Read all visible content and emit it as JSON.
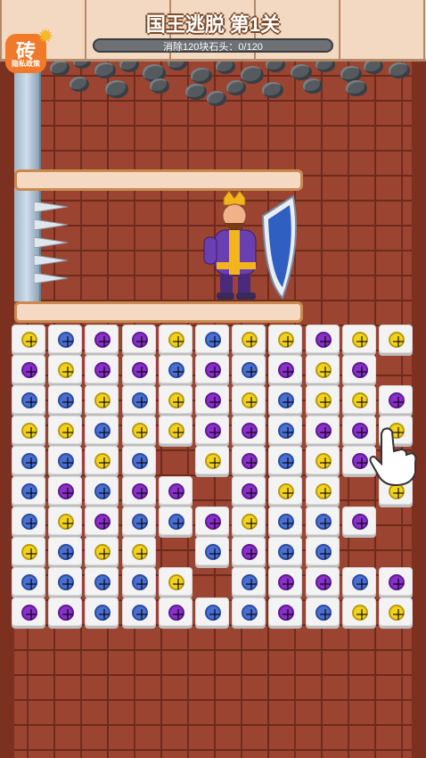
{
  "header": {
    "title": "国王逃脱  第1关",
    "progress_text": "消除120块石头：0/120"
  },
  "logo": {
    "glyph": "砖",
    "label": "隐私政策"
  },
  "icons": [
    "gear-icon",
    "pointer-hand-icon",
    "shield-icon"
  ],
  "colors": {
    "yellow": "#f3d21c",
    "purple": "#8a2fc9",
    "blue": "#4a6fd3"
  },
  "board": {
    "rows": [
      [
        [
          "y",
          0
        ],
        [
          "b",
          1
        ],
        [
          "p",
          2
        ],
        [
          "p",
          3
        ],
        [
          "y",
          4
        ],
        [
          "b",
          5
        ],
        [
          "y",
          6
        ],
        [
          "y",
          7
        ],
        [
          "p",
          8
        ],
        [
          "y",
          9
        ],
        [
          "y",
          10
        ]
      ],
      [
        [
          "p",
          0
        ],
        [
          "y",
          1
        ],
        [
          "p",
          2
        ],
        [
          "p",
          3
        ],
        [
          "b",
          4
        ],
        [
          "p",
          5
        ],
        [
          "b",
          6
        ],
        [
          "p",
          7
        ],
        [
          "y",
          8
        ],
        [
          "p",
          9
        ]
      ],
      [
        [
          "b",
          0
        ],
        [
          "b",
          1
        ],
        [
          "y",
          2
        ],
        [
          "b",
          3
        ],
        [
          "y",
          4
        ],
        [
          "p",
          5
        ],
        [
          "y",
          6
        ],
        [
          "b",
          7
        ],
        [
          "y",
          8
        ],
        [
          "y",
          9
        ],
        [
          "p",
          10
        ]
      ],
      [
        [
          "y",
          0
        ],
        [
          "y",
          1
        ],
        [
          "b",
          2
        ],
        [
          "y",
          3
        ],
        [
          "y",
          4
        ],
        [
          "p",
          5
        ],
        [
          "p",
          6
        ],
        [
          "b",
          7
        ],
        [
          "p",
          8
        ],
        [
          "p",
          9
        ],
        [
          "y",
          10
        ]
      ],
      [
        [
          "b",
          0
        ],
        [
          "b",
          1
        ],
        [
          "y",
          2
        ],
        [
          "b",
          3
        ],
        [
          "y",
          5
        ],
        [
          "p",
          6
        ],
        [
          "b",
          7
        ],
        [
          "y",
          8
        ],
        [
          "p",
          9
        ]
      ],
      [
        [
          "b",
          0
        ],
        [
          "p",
          1
        ],
        [
          "b",
          2
        ],
        [
          "p",
          3
        ],
        [
          "p",
          4
        ],
        [
          "p",
          6
        ],
        [
          "y",
          7
        ],
        [
          "y",
          8
        ],
        [
          "y",
          10
        ]
      ],
      [
        [
          "b",
          0
        ],
        [
          "y",
          1
        ],
        [
          "p",
          2
        ],
        [
          "b",
          3
        ],
        [
          "b",
          4
        ],
        [
          "p",
          5
        ],
        [
          "y",
          6
        ],
        [
          "b",
          7
        ],
        [
          "b",
          8
        ],
        [
          "p",
          9
        ]
      ],
      [
        [
          "y",
          0
        ],
        [
          "b",
          1
        ],
        [
          "y",
          2
        ],
        [
          "y",
          3
        ],
        [
          "b",
          5
        ],
        [
          "p",
          6
        ],
        [
          "b",
          7
        ],
        [
          "b",
          8
        ]
      ],
      [
        [
          "b",
          0
        ],
        [
          "b",
          1
        ],
        [
          "b",
          2
        ],
        [
          "b",
          3
        ],
        [
          "y",
          4
        ],
        [
          "b",
          6
        ],
        [
          "p",
          7
        ],
        [
          "p",
          8
        ],
        [
          "b",
          9
        ],
        [
          "p",
          10
        ]
      ],
      [
        [
          "p",
          0
        ],
        [
          "p",
          1
        ],
        [
          "b",
          2
        ],
        [
          "b",
          3
        ],
        [
          "p",
          4
        ],
        [
          "b",
          5
        ],
        [
          "b",
          6
        ],
        [
          "p",
          7
        ],
        [
          "b",
          8
        ],
        [
          "y",
          9
        ],
        [
          "y",
          10
        ]
      ]
    ]
  }
}
